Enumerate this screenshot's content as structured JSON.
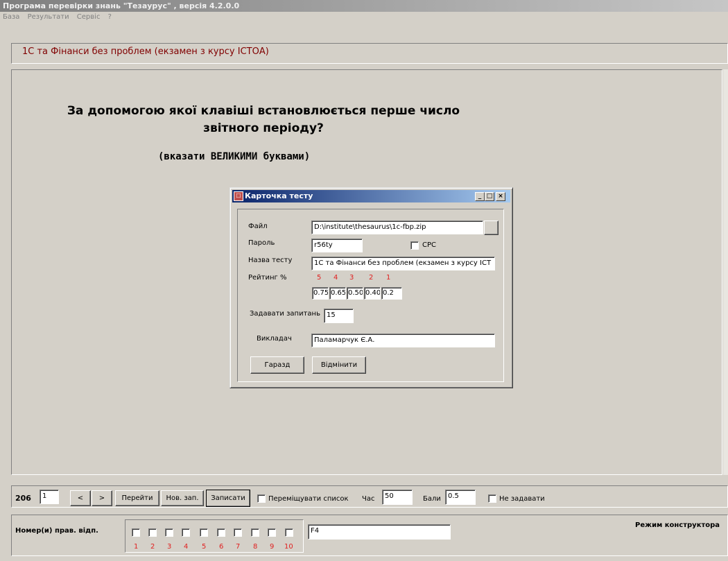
{
  "window": {
    "title": "Програма перевірки знань \"Тезаурус\" , версія 4.2.0.0"
  },
  "menu": [
    "База",
    "Результати",
    "Сервіс",
    "?"
  ],
  "test_title": "1С та Фінанси без проблем (екзамен з курсу ІСТОА)",
  "question": {
    "line1": "За допомогою якої клавіші встановлюється перше число",
    "line2": "звітного періоду?",
    "hint": "(вказати ВЕЛИКИМИ буквами)"
  },
  "dialog": {
    "title": "Карточка тесту",
    "file_label": "Файл",
    "file_value": "D:\\institute\\thesaurus\\1c-fbp.zip",
    "password_label": "Пароль",
    "password_value": "r56ty",
    "cpc_label": "СРС",
    "name_label": "Назва тесту",
    "name_value": "1С та Фінанси без проблем (екзамен з курсу ІСТ",
    "rating_label": "Рейтинг %",
    "rating_grades": [
      "5",
      "4",
      "3",
      "2",
      "1"
    ],
    "rating_values": [
      "0.75",
      "0.65",
      "0.50",
      "0.40",
      "0.2"
    ],
    "questions_label": "Задавати запитань",
    "questions_value": "15",
    "teacher_label": "Викладач",
    "teacher_value": "Паламарчук Є.А.",
    "ok_label": "Гаразд",
    "cancel_label": "Відмінити"
  },
  "toolbar": {
    "count": "206",
    "index_value": "1",
    "prev_label": "<",
    "next_label": ">",
    "goto_label": "Перейти",
    "new_label": "Нов. зап.",
    "save_label": "Записати",
    "shuffle_label": "Переміщувати список",
    "time_label": "Час",
    "time_value": "50",
    "score_label": "Бали",
    "score_value": "0.5",
    "noask_label": "Не задавати"
  },
  "answers": {
    "label": "Номер(и) прав. відп.",
    "numbers": [
      "1",
      "2",
      "3",
      "4",
      "5",
      "6",
      "7",
      "8",
      "9",
      "10"
    ],
    "answer_value": "F4",
    "mode_label": "Режим конструктора"
  }
}
